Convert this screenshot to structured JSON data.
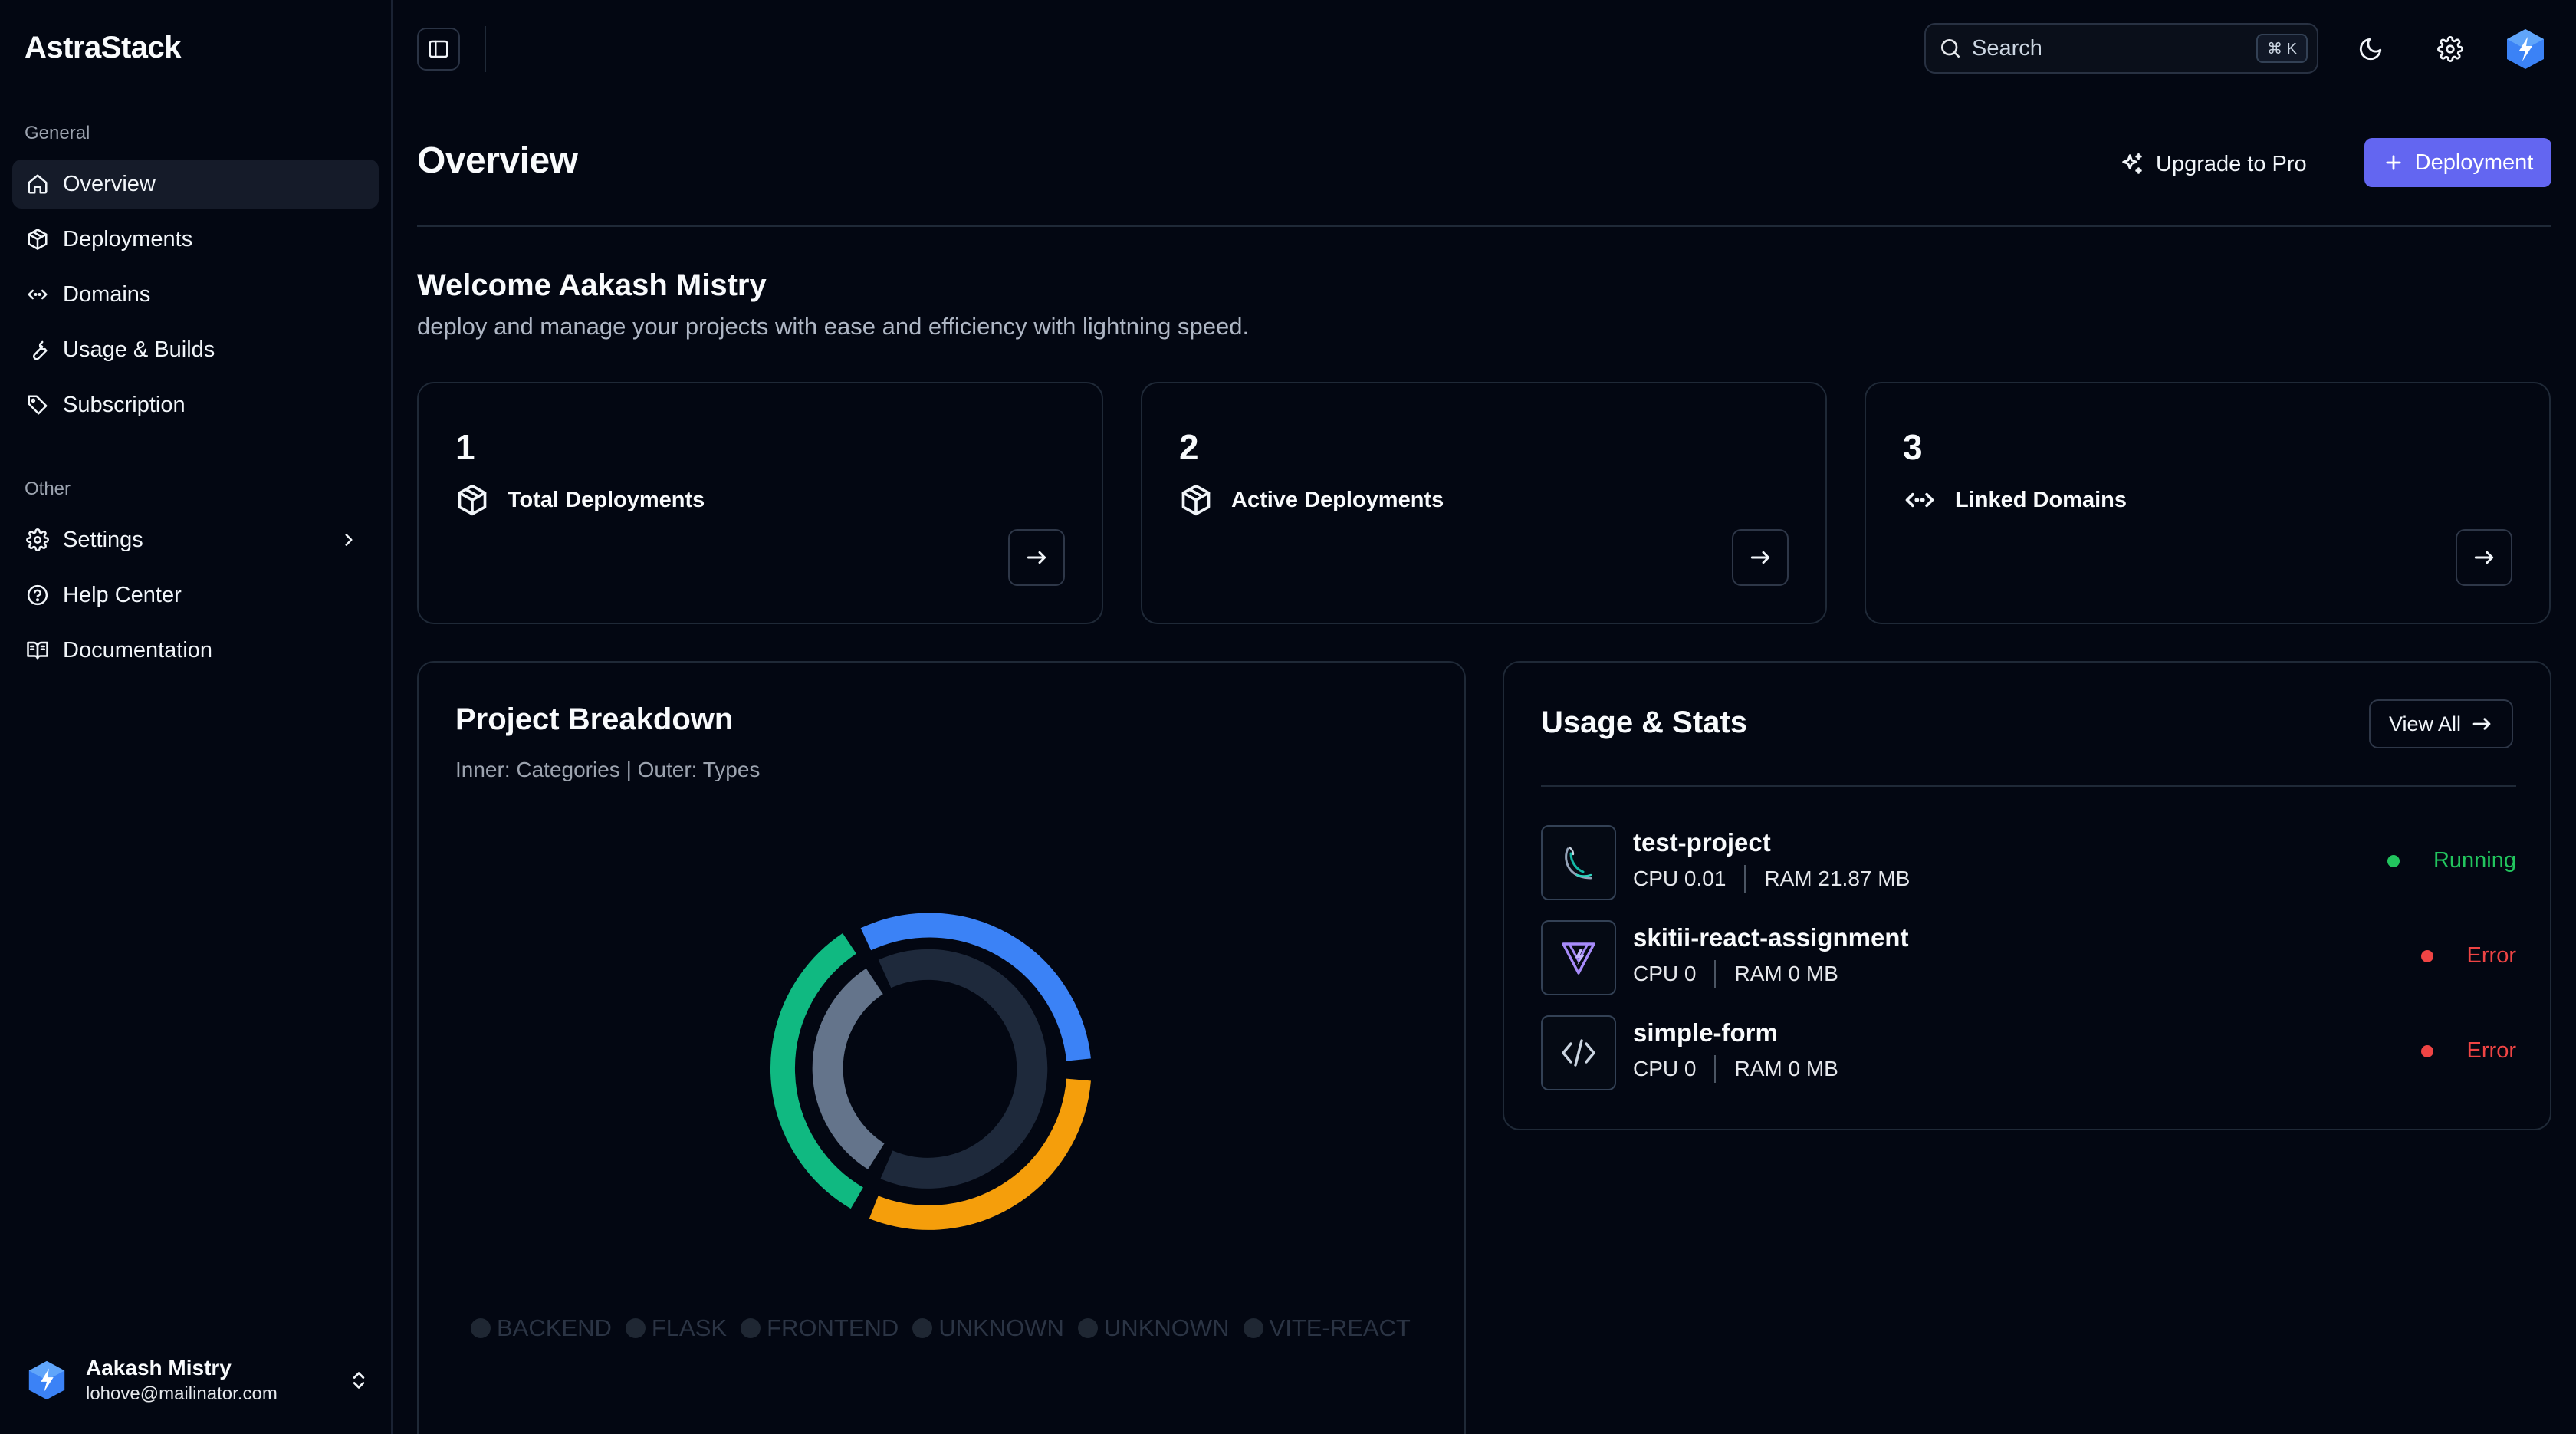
{
  "app": {
    "brand": "AstraStack"
  },
  "sidebar": {
    "general_label": "General",
    "other_label": "Other",
    "general_items": [
      {
        "label": "Overview",
        "icon": "home-icon",
        "active": true
      },
      {
        "label": "Deployments",
        "icon": "package-icon"
      },
      {
        "label": "Domains",
        "icon": "code-brackets-icon"
      },
      {
        "label": "Usage & Builds",
        "icon": "wrench-icon"
      },
      {
        "label": "Subscription",
        "icon": "tag-icon"
      }
    ],
    "other_items": [
      {
        "label": "Settings",
        "icon": "gear-icon"
      },
      {
        "label": "Help Center",
        "icon": "help-circle-icon"
      },
      {
        "label": "Documentation",
        "icon": "book-icon"
      }
    ],
    "user": {
      "name": "Aakash Mistry",
      "email": "lohove@mailinator.com"
    }
  },
  "topbar": {
    "search_placeholder": "Search",
    "search_shortcut": "⌘ K"
  },
  "header": {
    "title": "Overview",
    "upgrade_label": "Upgrade to Pro",
    "deploy_label": "Deployment"
  },
  "welcome": {
    "title": "Welcome Aakash Mistry",
    "subtitle": "deploy and manage your projects with ease and efficiency with lightning speed."
  },
  "stats": [
    {
      "value": "1",
      "label": "Total Deployments",
      "icon": "package-icon"
    },
    {
      "value": "2",
      "label": "Active Deployments",
      "icon": "package-icon"
    },
    {
      "value": "3",
      "label": "Linked Domains",
      "icon": "code-brackets-icon"
    }
  ],
  "breakdown": {
    "title": "Project Breakdown",
    "subtitle": "Inner: Categories | Outer: Types",
    "legend": [
      "BACKEND",
      "FLASK",
      "FRONTEND",
      "UNKNOWN",
      "UNKNOWN",
      "VITE-REACT"
    ],
    "colors": {
      "blue": "#3b82f6",
      "orange": "#f59e0b",
      "green": "#10b981",
      "slate_light": "#64748b",
      "slate_dark": "#1e293b"
    }
  },
  "usage": {
    "title": "Usage & Stats",
    "view_all_label": "View All",
    "projects": [
      {
        "name": "test-project",
        "cpu": "CPU 0.01",
        "ram": "RAM 21.87 MB",
        "status": "Running",
        "status_color": "#22c55e",
        "icon": "flask-icon"
      },
      {
        "name": "skitii-react-assignment",
        "cpu": "CPU 0",
        "ram": "RAM 0 MB",
        "status": "Error",
        "status_color": "#ef4444",
        "icon": "vite-icon"
      },
      {
        "name": "simple-form",
        "cpu": "CPU 0",
        "ram": "RAM 0 MB",
        "status": "Error",
        "status_color": "#ef4444",
        "icon": "code-icon"
      }
    ]
  },
  "colors": {
    "background": "#030712",
    "accent": "#6366f1",
    "border": "#1f2937"
  }
}
